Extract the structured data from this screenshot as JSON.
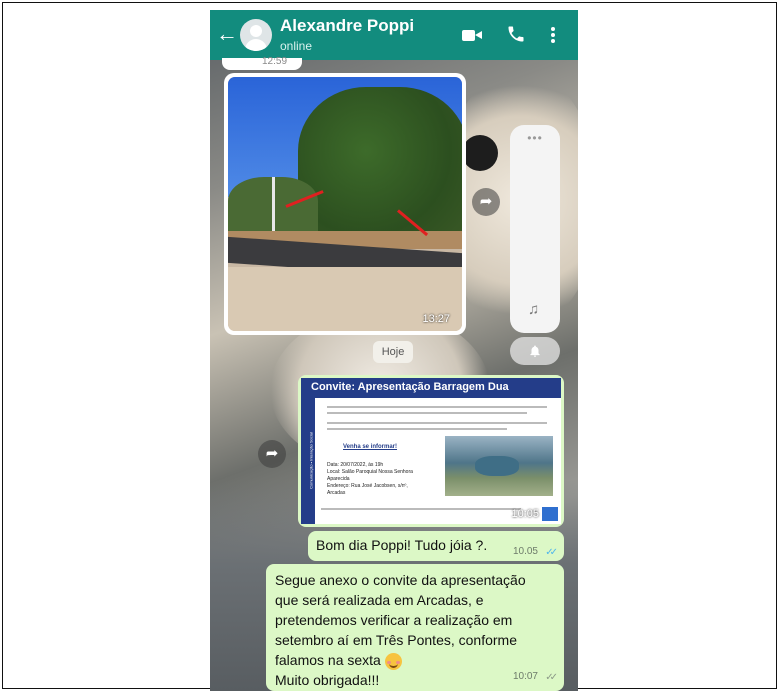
{
  "header": {
    "contact_name": "Alexandre Poppi",
    "status": "online",
    "back_glyph": "←",
    "icons": [
      "back-arrow-icon",
      "avatar",
      "video-call-icon",
      "phone-icon",
      "more-options-icon"
    ]
  },
  "previous_message": {
    "time": "12:59"
  },
  "image_message": {
    "time": "13:27",
    "forward_glyph": "➦"
  },
  "side_panel": {
    "dots": "•••",
    "music_glyph": "♫",
    "bell_glyph": "🔔",
    "moon_glyph": "☾"
  },
  "date_separator": "Hoje",
  "document_message": {
    "header_prefix": "Convite:",
    "header_title": "Apresentação Barragem Dua",
    "invite_line": "Venha se informar!",
    "info_lines": [
      "Data: 20/07/2022, às 19h",
      "Local: Salão Paroquial Nossa Senhora Aparecida",
      "Endereço: Rua José Jacobsen, s/nº, Arcadas"
    ],
    "side_text": "Comunicação • Interação Social",
    "time": "10:05",
    "forward_glyph": "➦"
  },
  "messages": [
    {
      "text": "Bom dia Poppi! Tudo jóia ?.",
      "time": "10.05",
      "ticks": "✓✓",
      "tick_color": "#4fb6ec"
    },
    {
      "lines": [
        "Segue anexo o convite da apresentação",
        "que será realizada em Arcadas, e",
        "pretendemos verificar a realização em",
        "setembro aí em Três Pontes, conforme",
        "falamos na sexta"
      ],
      "closing": "Muito obrigada!!!",
      "time": "10:07",
      "ticks": "✓✓",
      "tick_color": "#8c9a88"
    }
  ],
  "colors": {
    "header_bg": "#128c7e",
    "outgoing_bubble": "#dcf8c6",
    "doc_header": "#243d89"
  }
}
